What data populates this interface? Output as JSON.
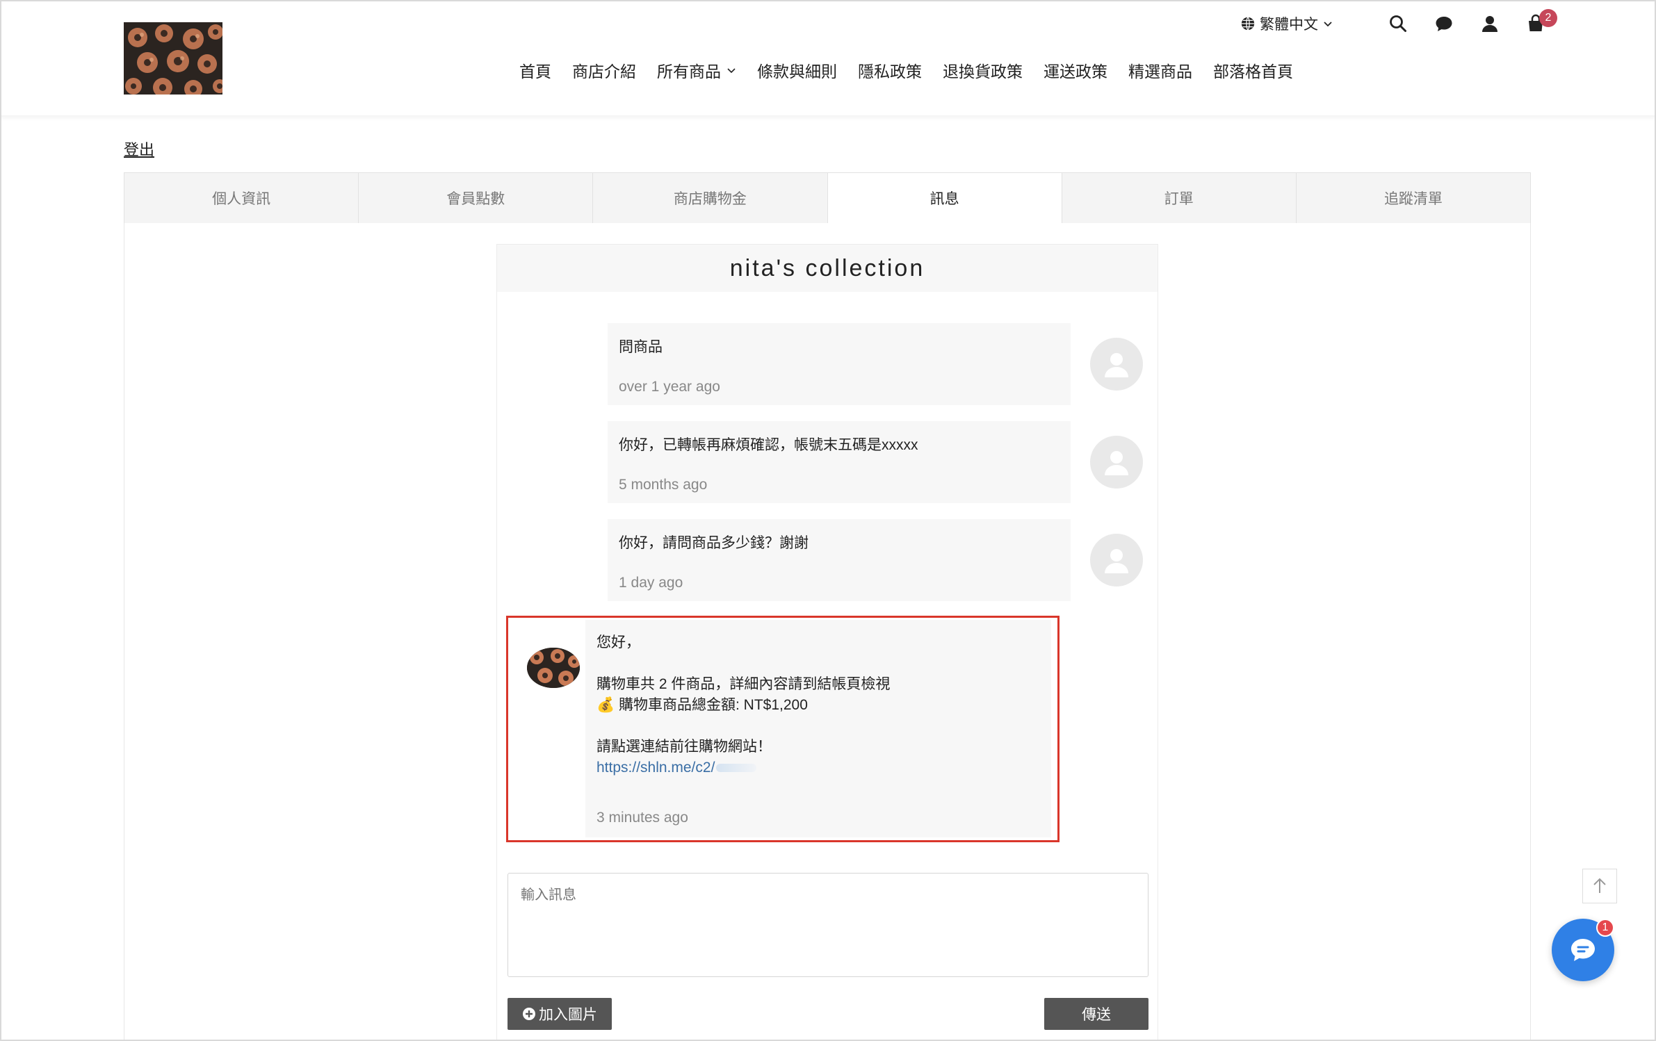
{
  "header": {
    "language": "繁體中文",
    "cart_count": "2",
    "nav": [
      "首頁",
      "商店介紹",
      "所有商品",
      "條款與細則",
      "隱私政策",
      "退換貨政策",
      "運送政策",
      "精選商品",
      "部落格首頁"
    ]
  },
  "account": {
    "logout": "登出",
    "tabs": [
      "個人資訊",
      "會員點數",
      "商店購物金",
      "訊息",
      "訂單",
      "追蹤清單"
    ],
    "active_tab": "訊息"
  },
  "chat": {
    "title": "nita's collection",
    "messages": [
      {
        "text": "問商品",
        "time": "over 1 year ago"
      },
      {
        "text": "你好，已轉帳再麻煩確認，帳號末五碼是xxxxx",
        "time": "5 months ago"
      },
      {
        "text": "你好，請問商品多少錢？謝謝",
        "time": "1 day ago"
      }
    ],
    "store_message": {
      "greeting": "您好，",
      "cart_line": "購物車共 2 件商品，詳細內容請到結帳頁檢視",
      "total_line": "💰 購物車商品總金額: NT$1,200",
      "prompt_line": "請點選連結前往購物網站！",
      "link": "https://shln.me/c2/",
      "time": "3 minutes ago"
    },
    "input_placeholder": "輸入訊息",
    "add_image_label": "加入圖片",
    "send_label": "傳送"
  },
  "floating": {
    "chat_badge": "1"
  },
  "colors": {
    "highlight": "#d9362b",
    "cart_badge": "#c6475a",
    "fab": "#2f80e6",
    "button": "#555555",
    "link": "#3a6ea5"
  }
}
